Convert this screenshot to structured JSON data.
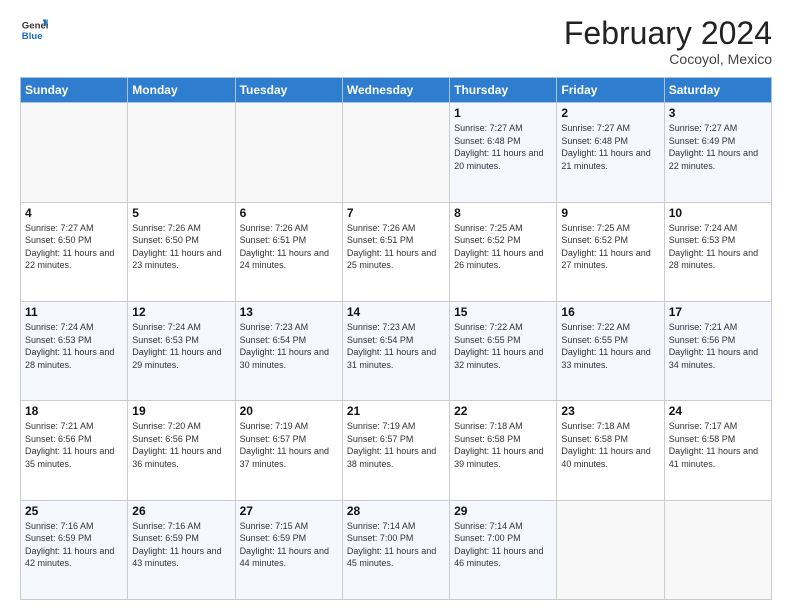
{
  "header": {
    "logo_general": "General",
    "logo_blue": "Blue",
    "month_title": "February 2024",
    "subtitle": "Cocoyol, Mexico"
  },
  "calendar": {
    "weekdays": [
      "Sunday",
      "Monday",
      "Tuesday",
      "Wednesday",
      "Thursday",
      "Friday",
      "Saturday"
    ],
    "weeks": [
      [
        {
          "day": "",
          "info": ""
        },
        {
          "day": "",
          "info": ""
        },
        {
          "day": "",
          "info": ""
        },
        {
          "day": "",
          "info": ""
        },
        {
          "day": "1",
          "info": "Sunrise: 7:27 AM\nSunset: 6:48 PM\nDaylight: 11 hours and 20 minutes."
        },
        {
          "day": "2",
          "info": "Sunrise: 7:27 AM\nSunset: 6:48 PM\nDaylight: 11 hours and 21 minutes."
        },
        {
          "day": "3",
          "info": "Sunrise: 7:27 AM\nSunset: 6:49 PM\nDaylight: 11 hours and 22 minutes."
        }
      ],
      [
        {
          "day": "4",
          "info": "Sunrise: 7:27 AM\nSunset: 6:50 PM\nDaylight: 11 hours and 22 minutes."
        },
        {
          "day": "5",
          "info": "Sunrise: 7:26 AM\nSunset: 6:50 PM\nDaylight: 11 hours and 23 minutes."
        },
        {
          "day": "6",
          "info": "Sunrise: 7:26 AM\nSunset: 6:51 PM\nDaylight: 11 hours and 24 minutes."
        },
        {
          "day": "7",
          "info": "Sunrise: 7:26 AM\nSunset: 6:51 PM\nDaylight: 11 hours and 25 minutes."
        },
        {
          "day": "8",
          "info": "Sunrise: 7:25 AM\nSunset: 6:52 PM\nDaylight: 11 hours and 26 minutes."
        },
        {
          "day": "9",
          "info": "Sunrise: 7:25 AM\nSunset: 6:52 PM\nDaylight: 11 hours and 27 minutes."
        },
        {
          "day": "10",
          "info": "Sunrise: 7:24 AM\nSunset: 6:53 PM\nDaylight: 11 hours and 28 minutes."
        }
      ],
      [
        {
          "day": "11",
          "info": "Sunrise: 7:24 AM\nSunset: 6:53 PM\nDaylight: 11 hours and 28 minutes."
        },
        {
          "day": "12",
          "info": "Sunrise: 7:24 AM\nSunset: 6:53 PM\nDaylight: 11 hours and 29 minutes."
        },
        {
          "day": "13",
          "info": "Sunrise: 7:23 AM\nSunset: 6:54 PM\nDaylight: 11 hours and 30 minutes."
        },
        {
          "day": "14",
          "info": "Sunrise: 7:23 AM\nSunset: 6:54 PM\nDaylight: 11 hours and 31 minutes."
        },
        {
          "day": "15",
          "info": "Sunrise: 7:22 AM\nSunset: 6:55 PM\nDaylight: 11 hours and 32 minutes."
        },
        {
          "day": "16",
          "info": "Sunrise: 7:22 AM\nSunset: 6:55 PM\nDaylight: 11 hours and 33 minutes."
        },
        {
          "day": "17",
          "info": "Sunrise: 7:21 AM\nSunset: 6:56 PM\nDaylight: 11 hours and 34 minutes."
        }
      ],
      [
        {
          "day": "18",
          "info": "Sunrise: 7:21 AM\nSunset: 6:56 PM\nDaylight: 11 hours and 35 minutes."
        },
        {
          "day": "19",
          "info": "Sunrise: 7:20 AM\nSunset: 6:56 PM\nDaylight: 11 hours and 36 minutes."
        },
        {
          "day": "20",
          "info": "Sunrise: 7:19 AM\nSunset: 6:57 PM\nDaylight: 11 hours and 37 minutes."
        },
        {
          "day": "21",
          "info": "Sunrise: 7:19 AM\nSunset: 6:57 PM\nDaylight: 11 hours and 38 minutes."
        },
        {
          "day": "22",
          "info": "Sunrise: 7:18 AM\nSunset: 6:58 PM\nDaylight: 11 hours and 39 minutes."
        },
        {
          "day": "23",
          "info": "Sunrise: 7:18 AM\nSunset: 6:58 PM\nDaylight: 11 hours and 40 minutes."
        },
        {
          "day": "24",
          "info": "Sunrise: 7:17 AM\nSunset: 6:58 PM\nDaylight: 11 hours and 41 minutes."
        }
      ],
      [
        {
          "day": "25",
          "info": "Sunrise: 7:16 AM\nSunset: 6:59 PM\nDaylight: 11 hours and 42 minutes."
        },
        {
          "day": "26",
          "info": "Sunrise: 7:16 AM\nSunset: 6:59 PM\nDaylight: 11 hours and 43 minutes."
        },
        {
          "day": "27",
          "info": "Sunrise: 7:15 AM\nSunset: 6:59 PM\nDaylight: 11 hours and 44 minutes."
        },
        {
          "day": "28",
          "info": "Sunrise: 7:14 AM\nSunset: 7:00 PM\nDaylight: 11 hours and 45 minutes."
        },
        {
          "day": "29",
          "info": "Sunrise: 7:14 AM\nSunset: 7:00 PM\nDaylight: 11 hours and 46 minutes."
        },
        {
          "day": "",
          "info": ""
        },
        {
          "day": "",
          "info": ""
        }
      ]
    ]
  }
}
